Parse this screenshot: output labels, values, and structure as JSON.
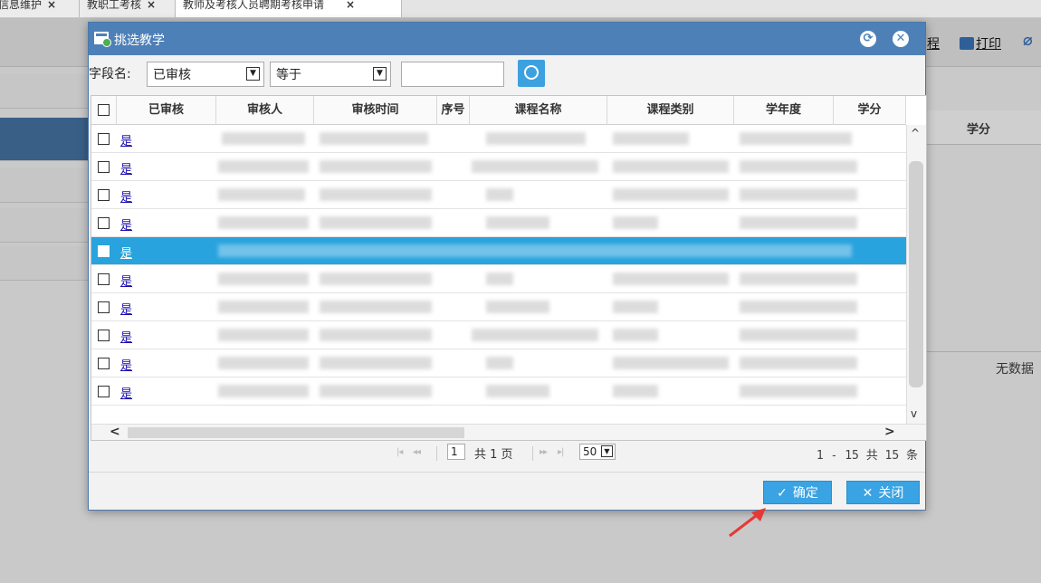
{
  "tabs": [
    {
      "label": "信息维护"
    },
    {
      "label": "教职工考核"
    },
    {
      "label": "教师及考核人员聘期考核申请"
    }
  ],
  "toolbar": {
    "partial_label": "程",
    "print_label": "打印"
  },
  "background_table": {
    "credit_header": "学分",
    "no_data": "无数据"
  },
  "modal": {
    "title": "挑选教学",
    "filter": {
      "label": "字段名:",
      "field_value": "已审核",
      "operator_value": "等于",
      "search_value": ""
    },
    "columns": [
      "已审核",
      "审核人",
      "审核时间",
      "序号",
      "课程名称",
      "课程类别",
      "学年度",
      "学分"
    ],
    "rows": [
      {
        "reviewed": "是"
      },
      {
        "reviewed": "是"
      },
      {
        "reviewed": "是"
      },
      {
        "reviewed": "是"
      },
      {
        "reviewed": "是",
        "selected": true
      },
      {
        "reviewed": "是"
      },
      {
        "reviewed": "是"
      },
      {
        "reviewed": "是"
      },
      {
        "reviewed": "是"
      },
      {
        "reviewed": "是"
      }
    ],
    "pager": {
      "page": "1",
      "total_pages_text": "共 1 页",
      "page_size": "50",
      "info": "1 - 15  共 15 条"
    },
    "confirm_label": "确定",
    "close_label": "关闭"
  },
  "colors": {
    "modal_header": "#4e80b8",
    "selected_row": "#29a3de",
    "button": "#3aa3e3",
    "annotation_arrow": "#e53935"
  }
}
